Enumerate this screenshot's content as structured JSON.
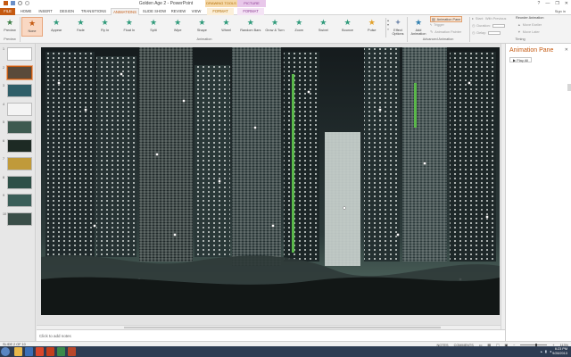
{
  "window": {
    "title": "Golden Age 2 - PowerPoint",
    "controls": [
      "?",
      "—",
      "❐",
      "✕"
    ],
    "contextual_groups": [
      "DRAWING TOOLS",
      "PICTURE TOOLS"
    ]
  },
  "tabs": [
    "FILE",
    "HOME",
    "INSERT",
    "DESIGN",
    "TRANSITIONS",
    "ANIMATIONS",
    "SLIDE SHOW",
    "REVIEW",
    "VIEW",
    "FORMAT",
    "FORMAT"
  ],
  "signin": "Sign in",
  "ribbon": {
    "preview_label": "Preview",
    "preview_group": "Preview",
    "animations": [
      {
        "label": "None",
        "icon": "none-star-icon"
      },
      {
        "label": "Appear",
        "icon": "appear-star-icon"
      },
      {
        "label": "Fade",
        "icon": "fade-star-icon"
      },
      {
        "label": "Fly In",
        "icon": "fly-in-star-icon"
      },
      {
        "label": "Float In",
        "icon": "float-in-star-icon"
      },
      {
        "label": "Split",
        "icon": "split-star-icon"
      },
      {
        "label": "Wipe",
        "icon": "wipe-star-icon"
      },
      {
        "label": "Shape",
        "icon": "shape-star-icon"
      },
      {
        "label": "Wheel",
        "icon": "wheel-star-icon"
      },
      {
        "label": "Random Bars",
        "icon": "random-bars-star-icon"
      },
      {
        "label": "Grow & Turn",
        "icon": "grow-turn-star-icon"
      },
      {
        "label": "Zoom",
        "icon": "zoom-star-icon"
      },
      {
        "label": "Swivel",
        "icon": "swivel-star-icon"
      },
      {
        "label": "Bounce",
        "icon": "bounce-star-icon"
      },
      {
        "label": "Pulse",
        "icon": "pulse-star-icon"
      }
    ],
    "animation_group": "Animation",
    "effect_options": "Effect Options",
    "add_animation": "Add Animation",
    "advanced_group": "Advanced Animation",
    "animation_pane_btn": "Animation Pane",
    "trigger": "Trigger",
    "animation_painter": "Animation Painter",
    "start_label": "Start:",
    "start_value": "With Previous",
    "duration_label": "Duration:",
    "delay_label": "Delay:",
    "timing_group": "Timing",
    "reorder_title": "Reorder Animation",
    "move_earlier": "Move Earlier",
    "move_later": "Move Later"
  },
  "thumbnails": [
    {
      "num": "1",
      "color": "#ffffff"
    },
    {
      "num": "2",
      "color": "#5a4a3a",
      "active": true
    },
    {
      "num": "3",
      "color": "#2f5e68"
    },
    {
      "num": "4",
      "color": "#f4f4f4"
    },
    {
      "num": "5",
      "color": "#3e5a50"
    },
    {
      "num": "6",
      "color": "#1d2a24"
    },
    {
      "num": "7",
      "color": "#c09a3a"
    },
    {
      "num": "8",
      "color": "#2e5048"
    },
    {
      "num": "9",
      "color": "#3a5e58"
    },
    {
      "num": "10",
      "color": "#3a4e48"
    }
  ],
  "notes_placeholder": "Click to add notes",
  "animation_pane": {
    "title": "Animation Pane",
    "close": "✕",
    "play_button": "Play All"
  },
  "status": {
    "slide_info": "SLIDE 2 OF 10",
    "notes": "NOTES",
    "comments": "COMMENTS",
    "zoom": "113%"
  },
  "taskbar": {
    "time": "6:23 PM",
    "date": "9/28/2013",
    "icons": [
      "#e8b84a",
      "#3b6fb6",
      "#d9472b",
      "#c43e1c",
      "#3a8a4a",
      "#b7472a"
    ]
  },
  "colors": {
    "accent": "#c55a11",
    "animation_star": "#2f9a7a",
    "slide_bg": "#171d1f"
  }
}
